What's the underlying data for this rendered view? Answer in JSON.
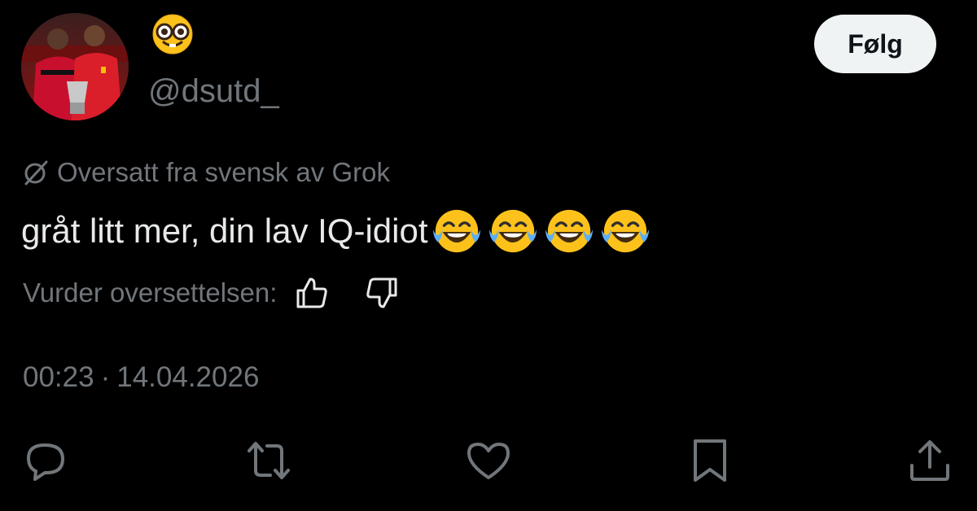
{
  "user": {
    "display_name_icon": "nerd-face-emoji",
    "handle": "@dsutd_",
    "avatar_icon": "two-footballers-in-red-kits-photo"
  },
  "follow_button": {
    "label": "Følg"
  },
  "translation": {
    "note": "Oversatt fra svensk av Grok",
    "rate_label": "Vurder oversettelsen:",
    "thumbs_up_icon": "thumbs-up-icon",
    "thumbs_down_icon": "thumbs-down-icon"
  },
  "tweet": {
    "text": "gråt litt mer, din lav IQ-idiot",
    "trailing_emoji": [
      "face-with-tears-of-joy",
      "face-with-tears-of-joy",
      "face-with-tears-of-joy",
      "face-with-tears-of-joy"
    ],
    "time": "00:23",
    "separator": "·",
    "date": "14.04.2026"
  },
  "actions": [
    "reply-icon",
    "retweet-icon",
    "like-icon",
    "bookmark-icon",
    "share-icon"
  ],
  "colors": {
    "background": "#000000",
    "text_primary": "#e7e9ea",
    "text_secondary": "#71767b",
    "follow_bg": "#eff3f4",
    "follow_text": "#0f1419"
  }
}
